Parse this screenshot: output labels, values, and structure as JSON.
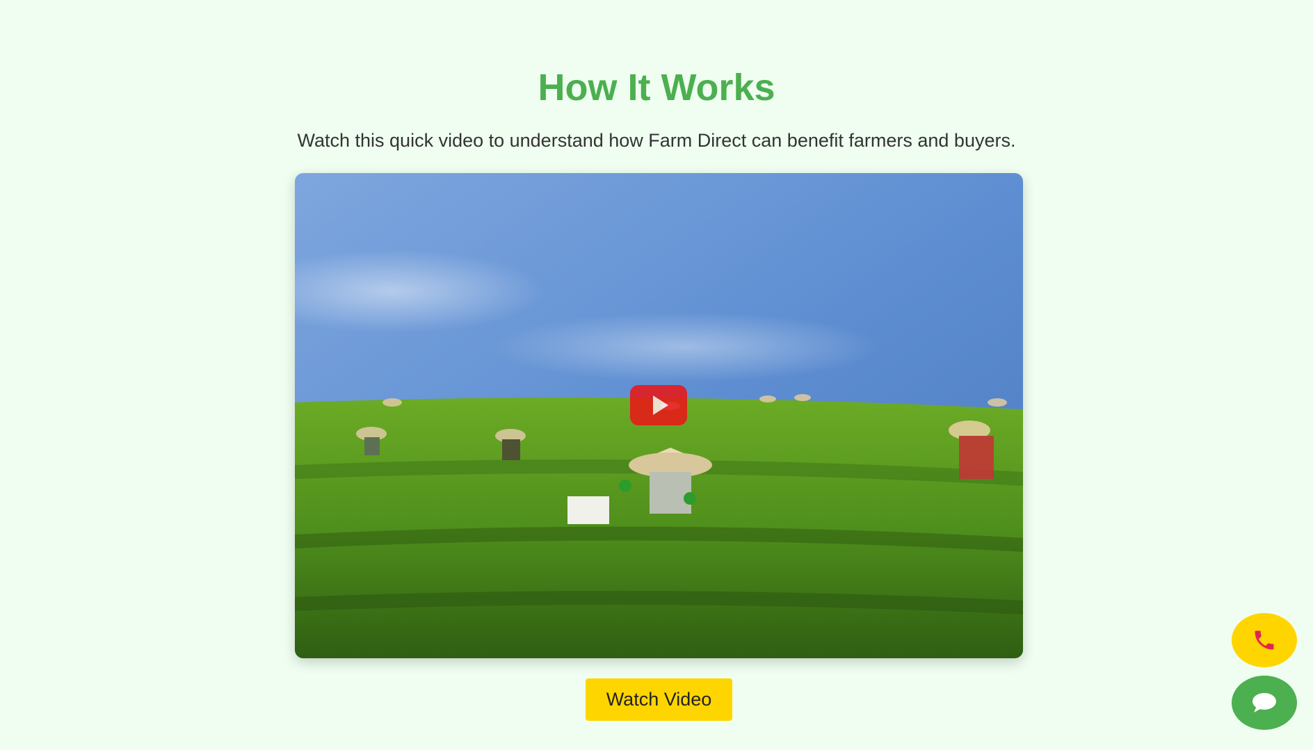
{
  "section": {
    "title": "How It Works",
    "subtitle": "Watch this quick video to understand how Farm Direct can benefit farmers and buyers.",
    "video": {
      "thumbnail_description_icon": "tea-plantation-thumbnail",
      "play_icon": "play-icon"
    },
    "watch_button_label": "Watch Video"
  },
  "floating_actions": {
    "call_icon": "phone-icon",
    "chat_icon": "chat-bubble-icon"
  },
  "colors": {
    "background": "#effef0",
    "title": "#4caf50",
    "accent_yellow": "#ffd500",
    "accent_green": "#4caf50",
    "play_red": "#e81818"
  }
}
